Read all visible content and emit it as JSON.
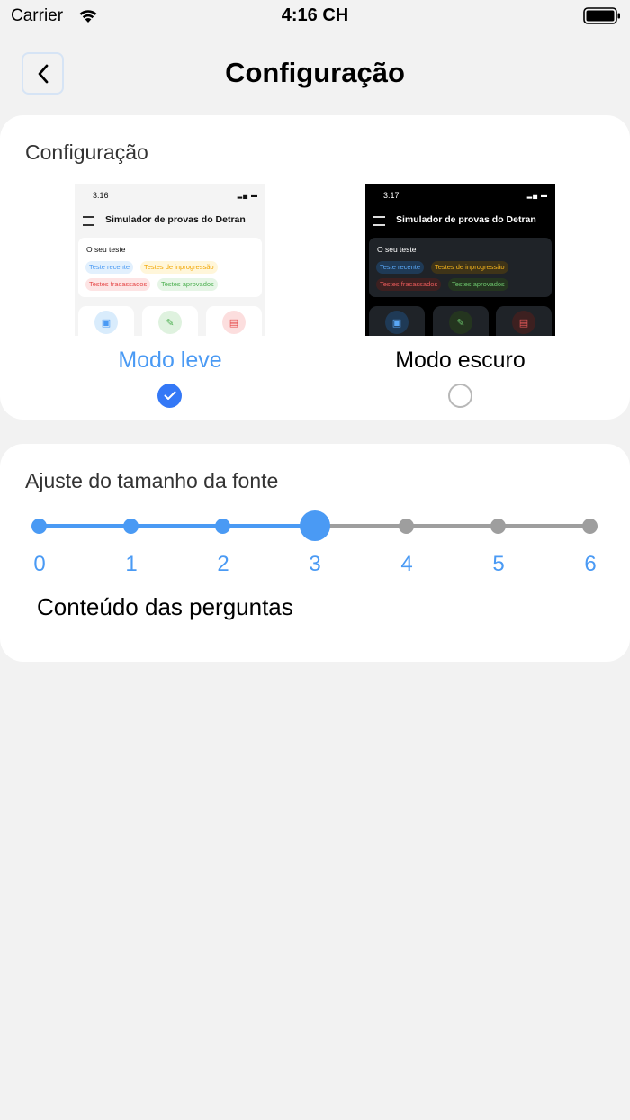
{
  "status_bar": {
    "carrier": "Carrier",
    "time": "4:16 CH"
  },
  "header": {
    "title": "Configuração",
    "back_icon": "chevron-left-icon"
  },
  "theme_section": {
    "heading": "Configuração",
    "selected": "light",
    "light": {
      "label": "Modo leve",
      "preview": {
        "time": "3:16",
        "app_title": "Simulador de provas do Detran",
        "box_title": "O seu teste",
        "chips": [
          "Teste recente",
          "Testes de inprogressão",
          "Testes fracassados",
          "Testes aprovados"
        ]
      }
    },
    "dark": {
      "label": "Modo escuro",
      "preview": {
        "time": "3:17",
        "app_title": "Simulador de provas do Detran",
        "box_title": "O seu teste",
        "chips": [
          "Teste recente",
          "Testes de inprogressão",
          "Testes fracassados",
          "Testes aprovados"
        ]
      }
    }
  },
  "font_section": {
    "heading": "Ajuste do tamanho da fonte",
    "ticks": [
      "0",
      "1",
      "2",
      "3",
      "4",
      "5",
      "6"
    ],
    "value": 3,
    "sample_text": "Conteúdo das perguntas"
  },
  "colors": {
    "accent": "#4a9af4",
    "radio_selected": "#3478f6",
    "track_inactive": "#9e9e9e"
  }
}
